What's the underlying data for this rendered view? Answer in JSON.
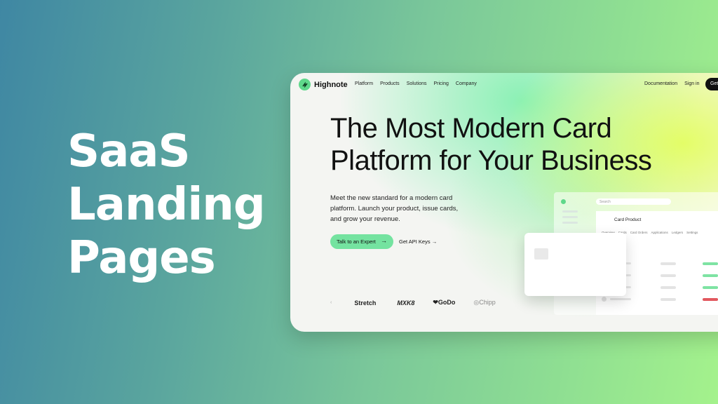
{
  "hero": {
    "line1": "SaaS",
    "line2": "Landing",
    "line3": "Pages"
  },
  "site": {
    "brand": "Highnote",
    "nav": [
      "Platform",
      "Products",
      "Solutions",
      "Pricing",
      "Company"
    ],
    "nav_right": [
      "Documentation",
      "Sign in"
    ],
    "cta_top": "Get",
    "headline_line1": "The Most Modern Card",
    "headline_line2": "Platform for Your Business",
    "subtext": "Meet the new standard for a modern card platform. Launch your product, issue cards, and grow your revenue.",
    "primary_cta": "Talk to an Expert",
    "secondary_cta": "Get API Keys →",
    "partner_logos": [
      "Stretch",
      "MXK8",
      "GoDo",
      "Chipp"
    ]
  },
  "dashboard": {
    "search_placeholder": "Search",
    "title": "Card Product",
    "tabs": [
      "Overview",
      "Cards",
      "Card Orders",
      "Applications",
      "Ledgers",
      "Settings"
    ],
    "row_status_colors": [
      "#7ee3a3",
      "#7ee3a3",
      "#7ee3a3",
      "#e2585f"
    ]
  },
  "colors": {
    "accent_green": "#74e3a0",
    "dark": "#111111"
  }
}
